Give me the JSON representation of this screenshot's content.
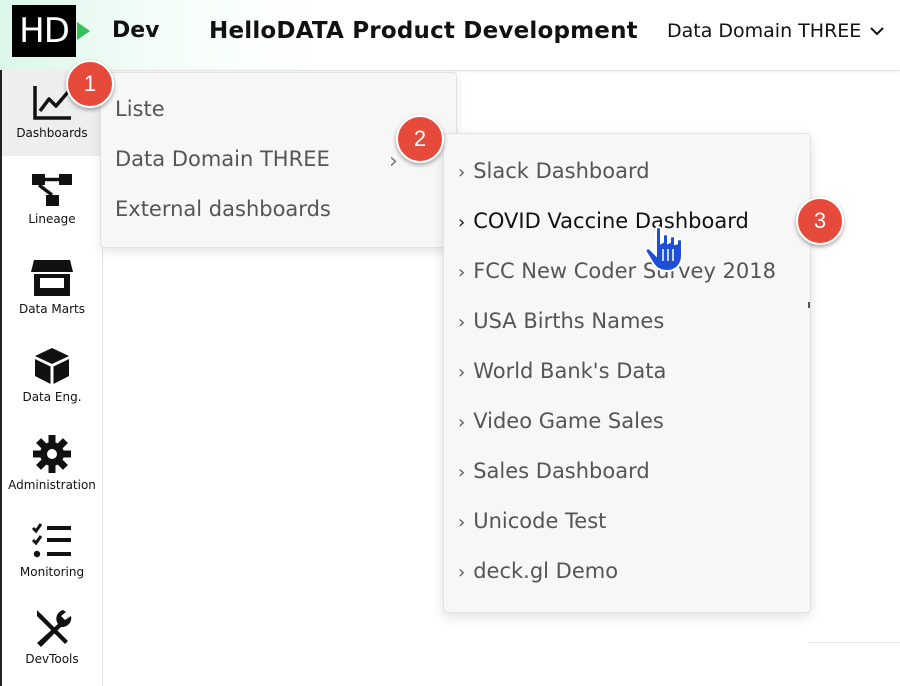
{
  "header": {
    "logo_text": "HD",
    "env_label": "Dev",
    "app_title": "HelloDATA Product Development",
    "domain_selector": "Data Domain THREE"
  },
  "sidebar": {
    "items": [
      {
        "label": "Dashboards",
        "icon": "chart-line-icon",
        "active": true
      },
      {
        "label": "Lineage",
        "icon": "lineage-icon"
      },
      {
        "label": "Data Marts",
        "icon": "store-icon"
      },
      {
        "label": "Data Eng.",
        "icon": "cube-icon"
      },
      {
        "label": "Administration",
        "icon": "gear-icon"
      },
      {
        "label": "Monitoring",
        "icon": "checklist-icon"
      },
      {
        "label": "DevTools",
        "icon": "tools-icon"
      }
    ]
  },
  "dashboard_menu": {
    "items": [
      {
        "label": "Liste"
      },
      {
        "label": "Data Domain THREE",
        "has_submenu": true
      },
      {
        "label": "External dashboards"
      }
    ]
  },
  "domain_submenu": {
    "items": [
      {
        "label": "Slack Dashboard"
      },
      {
        "label": "COVID Vaccine Dashboard",
        "hovered": true
      },
      {
        "label": "FCC New Coder Survey 2018"
      },
      {
        "label": "USA Births Names"
      },
      {
        "label": "World Bank's Data"
      },
      {
        "label": "Video Game Sales"
      },
      {
        "label": "Sales Dashboard"
      },
      {
        "label": "Unicode Test"
      },
      {
        "label": "deck.gl Demo"
      }
    ]
  },
  "callouts": [
    "1",
    "2",
    "3"
  ],
  "colors": {
    "badge": "#e64a3b",
    "logo_bg": "#000000",
    "logo_accent": "#35c25a",
    "cursor": "#1f4fd6"
  }
}
